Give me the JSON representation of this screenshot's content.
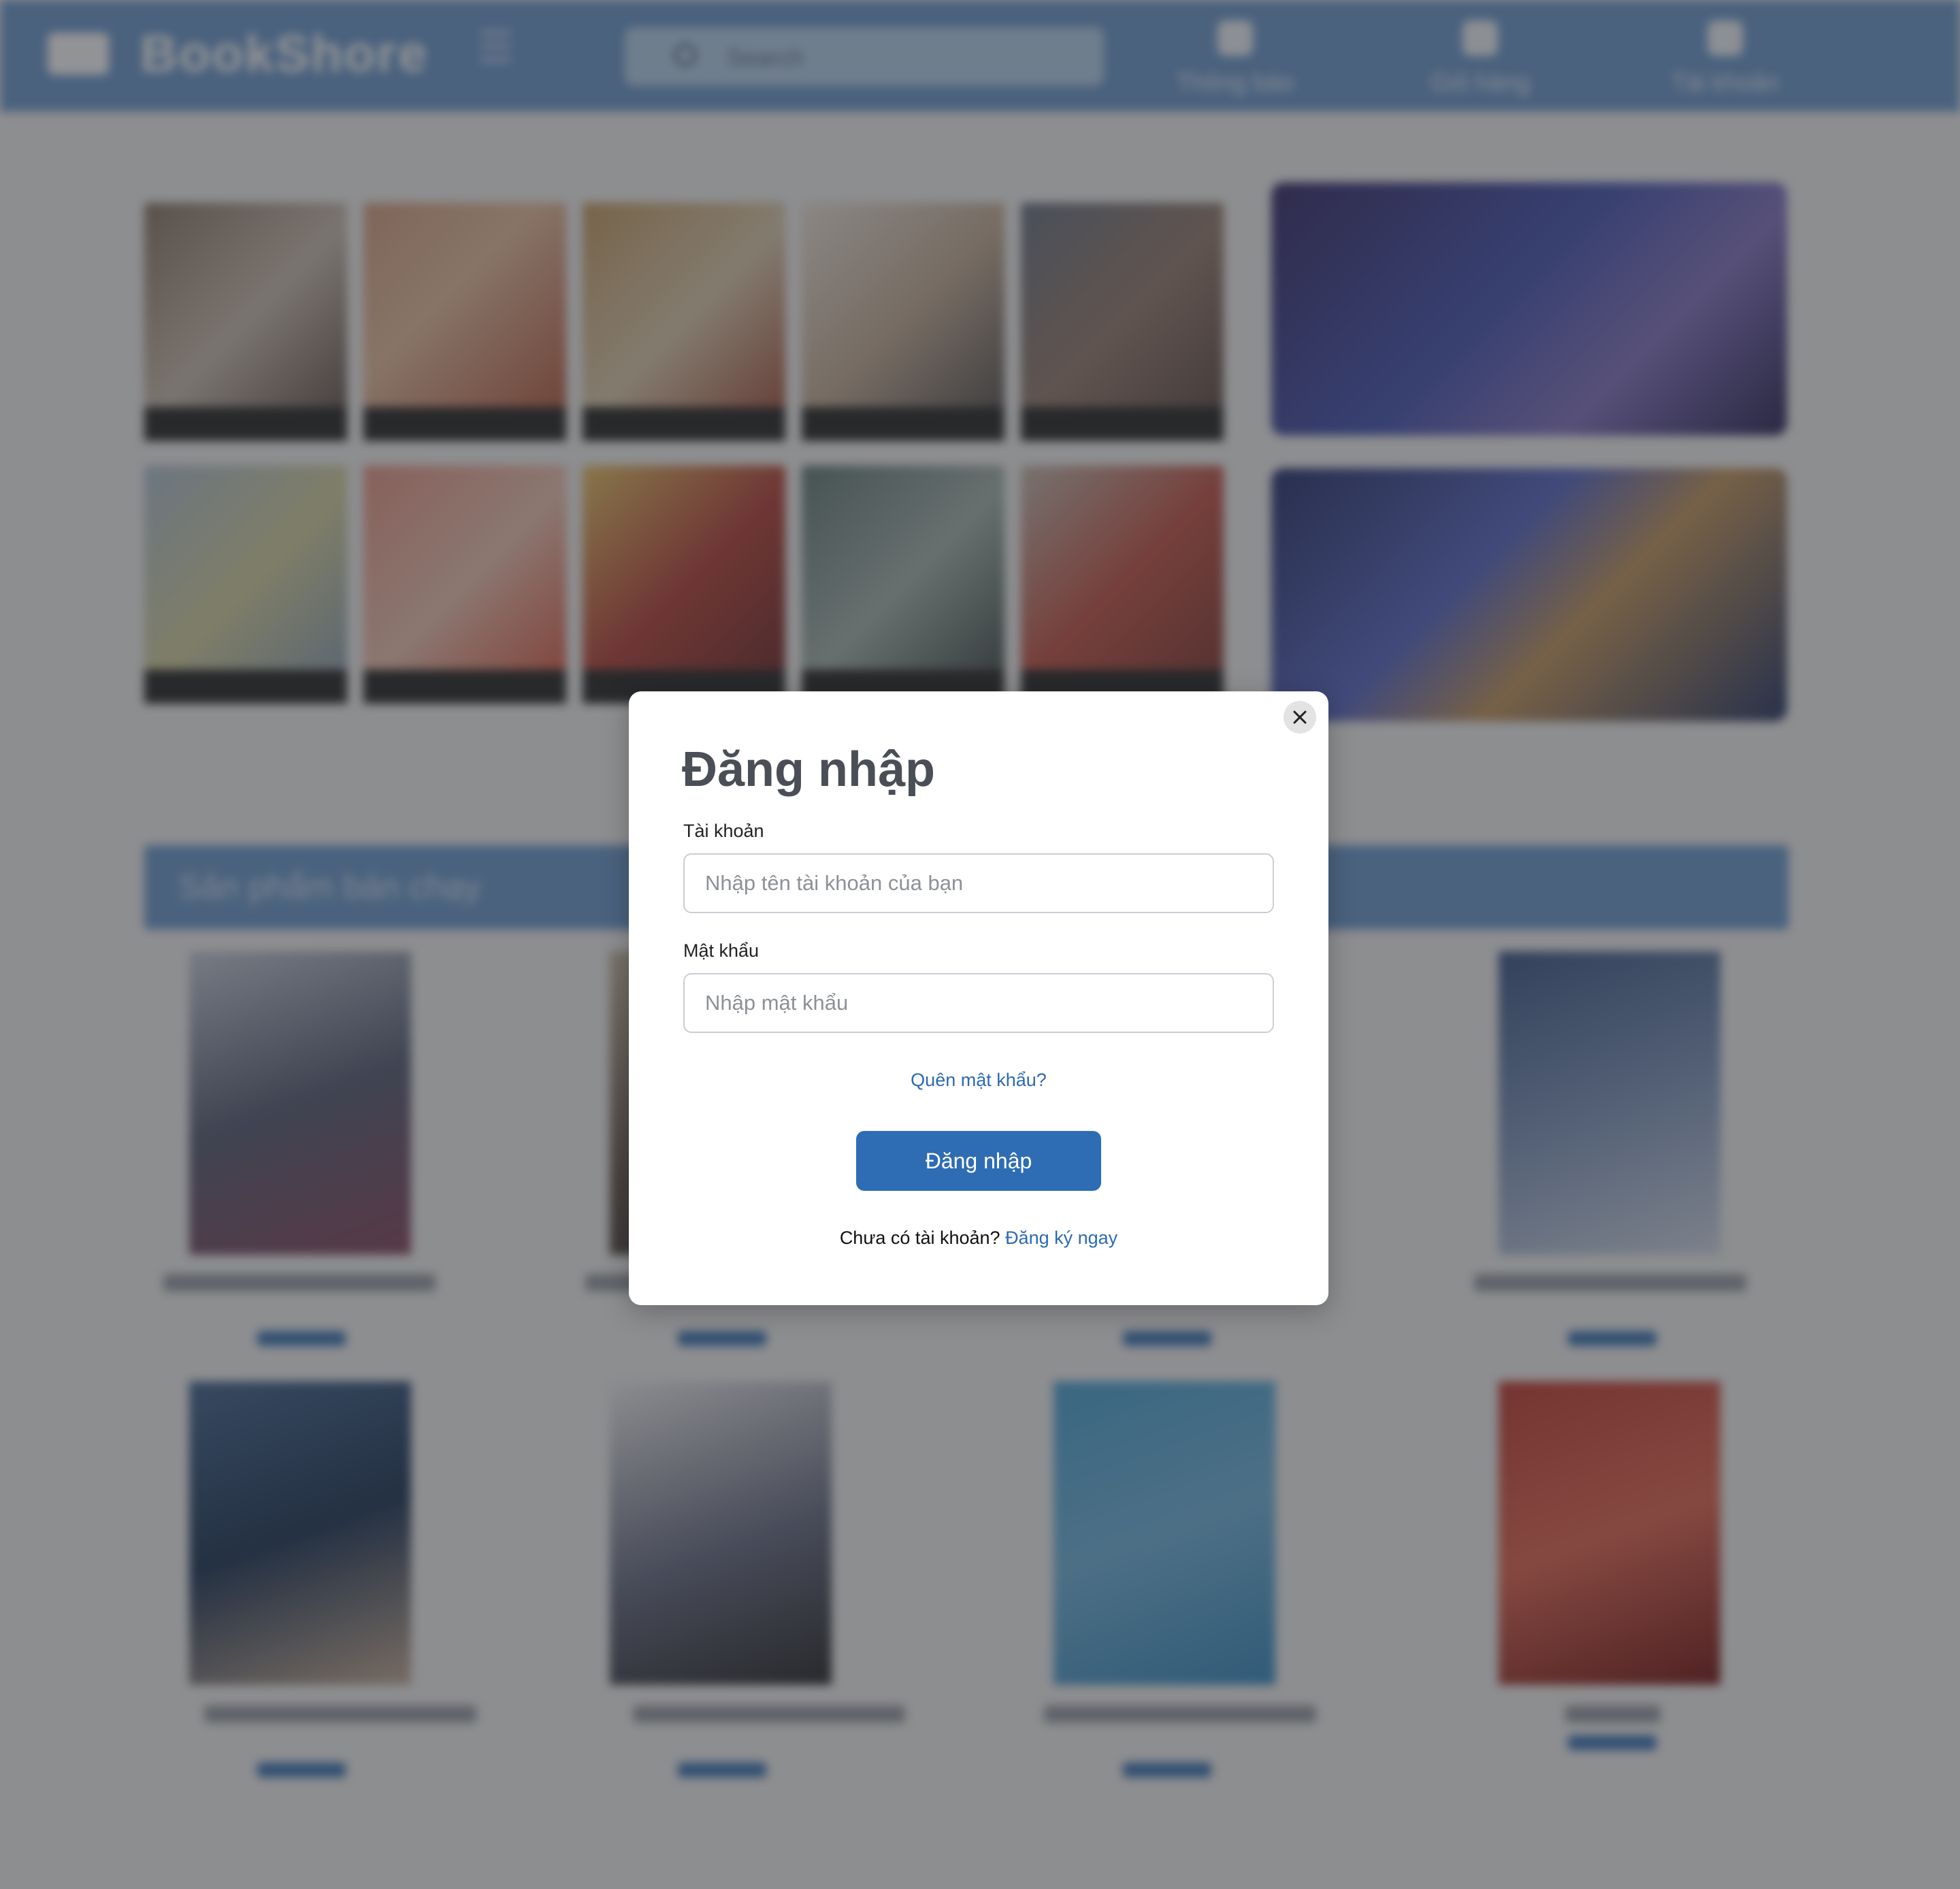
{
  "header": {
    "logo_text": "BookShore",
    "search_placeholder": "Search",
    "nav": [
      {
        "label": "Thông báo"
      },
      {
        "label": "Giỏ hàng"
      },
      {
        "label": "Tài khoản"
      }
    ]
  },
  "section": {
    "title": "Sản phẩm bán chạy"
  },
  "colors": {
    "header_bg": "#6f9cd1",
    "accent": "#2e6db3",
    "link": "#2d6ab0"
  },
  "login_modal": {
    "title": "Đăng nhập",
    "username_label": "Tài khoản",
    "username_placeholder": "Nhập tên tài khoản của bạn",
    "password_label": "Mật khẩu",
    "password_placeholder": "Nhập mật khẩu",
    "forgot_password": "Quên mật khẩu?",
    "submit_label": "Đăng nhập",
    "no_account_text": "Chưa có tài khoản?",
    "register_link": "Đăng ký ngay"
  }
}
